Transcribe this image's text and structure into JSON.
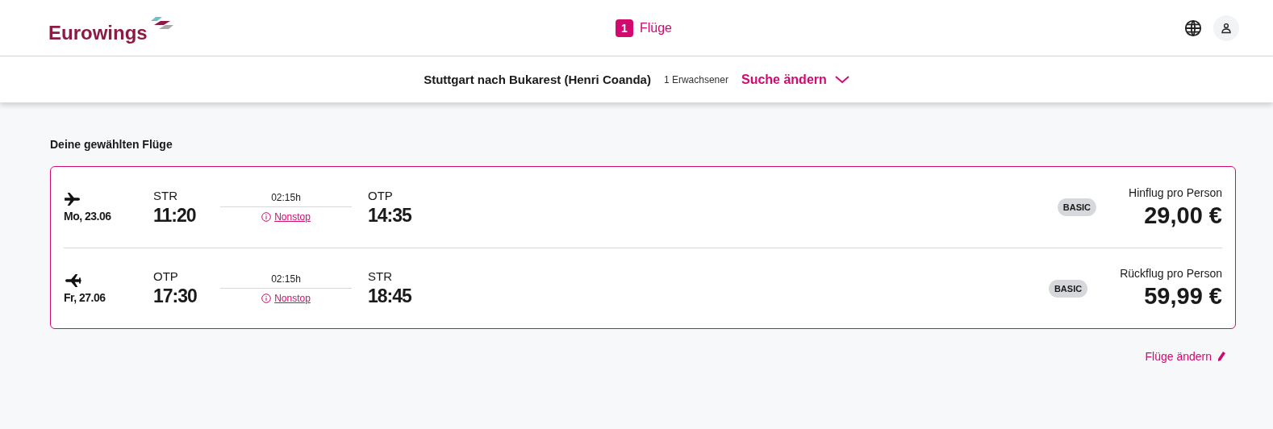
{
  "header": {
    "logo": "Eurowings",
    "step": {
      "number": "1",
      "label": "Flüge"
    }
  },
  "search_bar": {
    "route": "Stuttgart nach Bukarest (Henri Coanda)",
    "passengers": "1 Erwachsener",
    "change_search": "Suche ändern"
  },
  "section_title": "Deine gewählten Flüge",
  "flights": [
    {
      "kind": "outbound",
      "date": "Mo, 23.06",
      "from": "STR",
      "departure": "11:20",
      "duration": "02:15h",
      "stops": "Nonstop",
      "to": "OTP",
      "arrival": "14:35",
      "fare": "BASIC",
      "price_label": "Hinflug pro Person",
      "price": "29,00 €"
    },
    {
      "kind": "return",
      "date": "Fr, 27.06",
      "from": "OTP",
      "departure": "17:30",
      "duration": "02:15h",
      "stops": "Nonstop",
      "to": "STR",
      "arrival": "18:45",
      "fare": "BASIC",
      "price_label": "Rückflug pro Person",
      "price": "59,99 €"
    }
  ],
  "change_flights": "Flüge ändern"
}
